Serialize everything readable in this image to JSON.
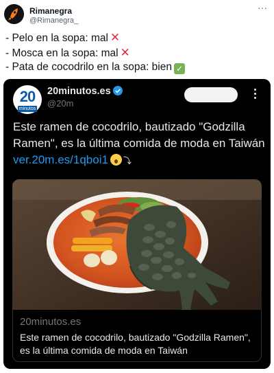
{
  "author": {
    "name": "Rimanegra",
    "handle": "@Rimanegra_"
  },
  "tweet": {
    "lines": [
      "- Pelo en la sopa: mal",
      "- Mosca en la sopa: mal",
      "- Pata de cocodrilo en la sopa: bien"
    ],
    "marks": [
      "cross-mark",
      "cross-mark",
      "check-mark"
    ]
  },
  "quoted": {
    "avatar_number": "20",
    "avatar_word": "minutos",
    "name": "20minutos.es",
    "handle": "@20m",
    "text": "Este ramen de cocodrilo, bautizado \"Godzilla Ramen\", es la última comida de moda en Taiwán",
    "link": "ver.20m.es/1qboi1",
    "card_domain": "20minutos.es",
    "card_title": "Este ramen de cocodrilo, bautizado \"Godzilla Ramen\", es la última comida de moda en Taiwán"
  },
  "colors": {
    "link_blue": "#1d9bf0",
    "card_bg": "#000000",
    "brand_blue": "#0d5aa7",
    "verified_blue": "#1d9bf0",
    "cross_red": "#dd2e44",
    "check_green": "#77b255"
  },
  "icons": {
    "more": "more-horizontal-icon",
    "verified": "verified-badge-icon",
    "scream": "face-screaming-in-fear-emoji",
    "arrow": "arrow-curving-down-emoji"
  }
}
